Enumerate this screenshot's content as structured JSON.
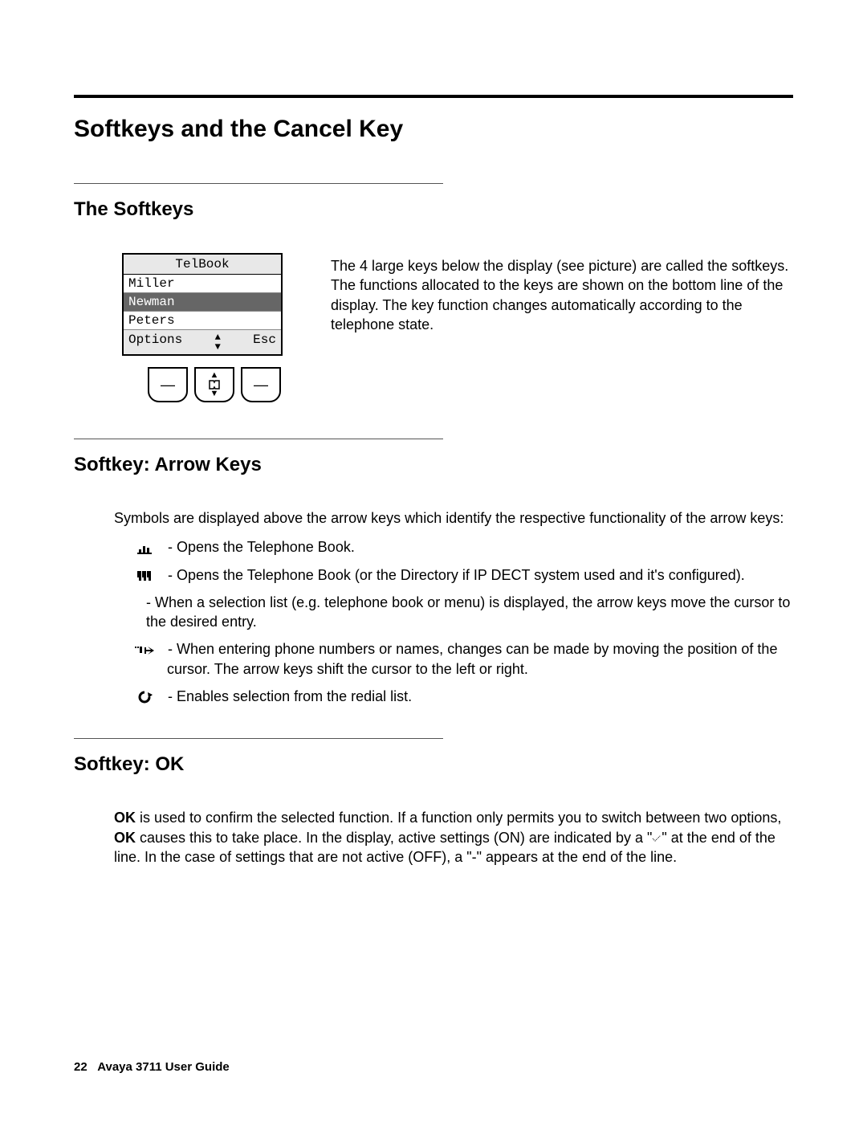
{
  "title": "Softkeys and the Cancel Key",
  "sections": {
    "softkeys": {
      "heading": "The Softkeys",
      "display": {
        "title": "TelBook",
        "items": [
          "Miller",
          "Newman",
          "Peters"
        ],
        "selected_index": 1,
        "softrow_left": "Options",
        "softrow_right": "Esc"
      },
      "intro": "The 4 large keys below the display (see picture) are called the softkeys. The functions allocated to the keys are shown on the bottom line of the display. The key function changes automatically according to the telephone state."
    },
    "arrow": {
      "heading": "Softkey: Arrow Keys",
      "intro": "Symbols are displayed above the arrow keys which identify the respective functionality of the arrow keys:",
      "items": [
        {
          "icon": "telbook",
          "text": " - Opens the Telephone Book."
        },
        {
          "icon": "directory",
          "text": " - Opens the Telephone Book (or the Directory if IP DECT system used and it's configured)."
        },
        {
          "icon": "",
          "text": "- When a selection list (e.g. telephone book or menu) is displayed, the arrow keys move the cursor to the desired entry."
        },
        {
          "icon": "cursor",
          "text": " - When entering phone numbers or names, changes can be made by moving the position of the cursor. The arrow keys shift the cursor to the left or right."
        },
        {
          "icon": "redial",
          "text": " - Enables selection from the redial list."
        }
      ]
    },
    "ok": {
      "heading": "Softkey: OK",
      "para_parts": {
        "p1a": "OK",
        "p1b": " is used to confirm the selected function. If a function only permits you to switch between two options, ",
        "p1c": "OK",
        "p1d": " causes this to take place. In the display, active settings (ON) are indicated by a \"",
        "p1e": "\" at the end of the line. In the case of settings that are not active (OFF), a \"-\" appears at the end of the line."
      }
    }
  },
  "footer": {
    "page": "22",
    "guide": "Avaya 3711 User Guide"
  }
}
